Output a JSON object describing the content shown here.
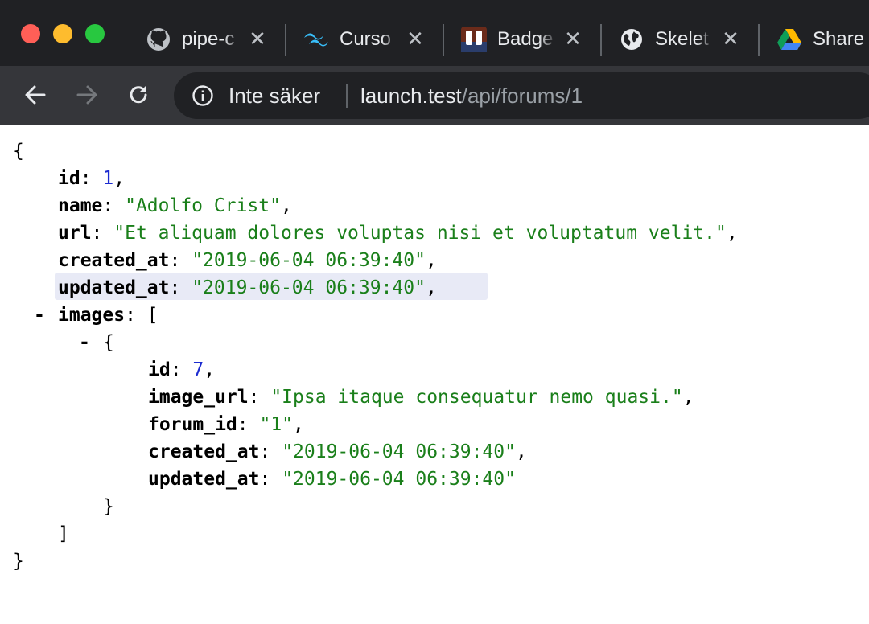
{
  "window": {
    "tabs": [
      {
        "title": "pipe-c",
        "icon": "github-icon"
      },
      {
        "title": "Curso",
        "icon": "tailwind-icon"
      },
      {
        "title": "Badge",
        "icon": "badge-app-icon"
      },
      {
        "title": "Skelet",
        "icon": "globe-icon"
      },
      {
        "title": "Share",
        "icon": "google-drive-icon"
      }
    ],
    "close_glyph": "✕"
  },
  "toolbar": {
    "security_label": "Inte säker",
    "url_host": "launch.test",
    "url_path": "/api/forums/1"
  },
  "json_view": {
    "open_brace": "{",
    "close_brace": "}",
    "collapse_glyph": "-",
    "forum": {
      "id_key": "id",
      "id_value": "1",
      "name_key": "name",
      "name_value": "\"Adolfo Crist\"",
      "url_key": "url",
      "url_value": "\"Et aliquam dolores voluptas nisi et voluptatum velit.\"",
      "created_at_key": "created_at",
      "created_at_value": "\"2019-06-04 06:39:40\"",
      "updated_at_key": "updated_at",
      "updated_at_value": "\"2019-06-04 06:39:40\"",
      "images_key": "images",
      "images_open": "[",
      "images_close": "]"
    },
    "image": {
      "open": "{",
      "close": "}",
      "id_key": "id",
      "id_value": "7",
      "image_url_key": "image_url",
      "image_url_value": "\"Ipsa itaque consequatur nemo quasi.\"",
      "forum_id_key": "forum_id",
      "forum_id_value": "\"1\"",
      "created_at_key": "created_at",
      "created_at_value": "\"2019-06-04 06:39:40\"",
      "updated_at_key": "updated_at",
      "updated_at_value": "\"2019-06-04 06:39:40\""
    }
  },
  "colors": {
    "tabstrip": "#202124",
    "toolbar": "#35363a",
    "string": "#1a7f1a",
    "number": "#1c2bd0",
    "highlight": "#e8eaf6"
  }
}
